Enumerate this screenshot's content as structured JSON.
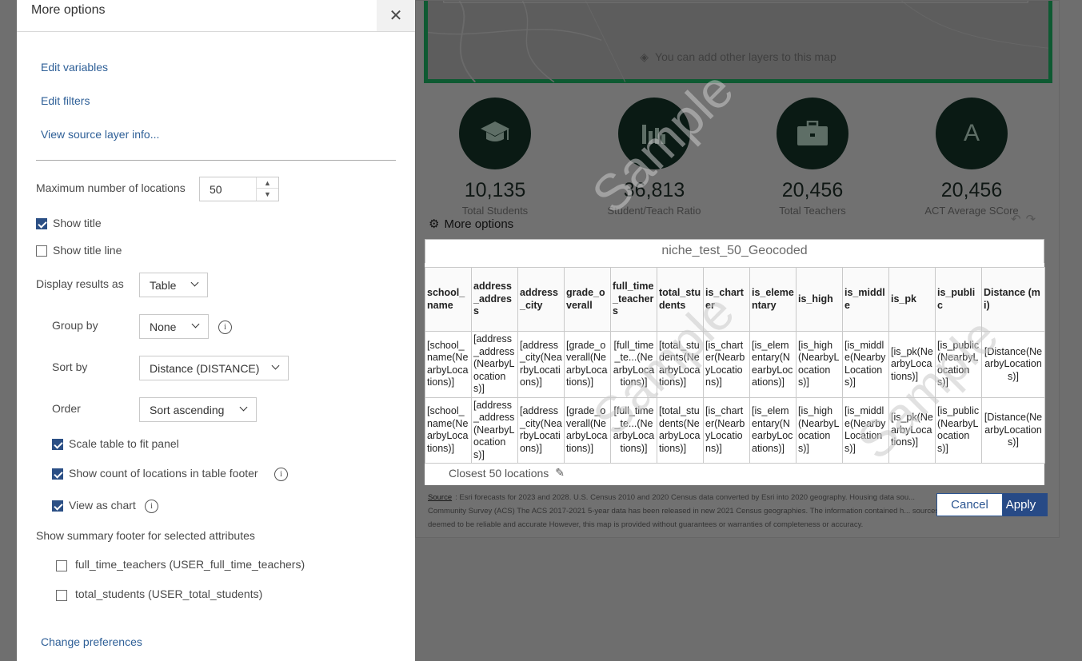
{
  "panel": {
    "title": "More options",
    "close_icon": "close-icon",
    "links": {
      "edit_variables": "Edit variables",
      "edit_filters": "Edit filters",
      "view_source": "View source layer info...",
      "change_preferences": "Change preferences"
    },
    "max_locations_label": "Maximum number of locations",
    "max_locations_value": "50",
    "show_title": {
      "label": "Show title",
      "checked": true
    },
    "show_title_line": {
      "label": "Show title line",
      "checked": false
    },
    "display_results_label": "Display results as",
    "display_results_value": "Table",
    "group_by_label": "Group by",
    "group_by_value": "None",
    "sort_by_label": "Sort by",
    "sort_by_value": "Distance (DISTANCE)",
    "order_label": "Order",
    "order_value": "Sort ascending",
    "scale_table": {
      "label": "Scale table to fit panel",
      "checked": true
    },
    "show_count": {
      "label": "Show count of locations in table footer",
      "checked": true
    },
    "view_chart": {
      "label": "View as chart",
      "checked": true
    },
    "summary_footer_label": "Show summary footer for selected attributes",
    "summary_attrs": [
      {
        "label": "full_time_teachers (USER_full_time_teachers)",
        "checked": false
      },
      {
        "label": "total_students (USER_total_students)",
        "checked": false
      }
    ]
  },
  "app": {
    "map_hint": "You can add other layers to this map",
    "stats": [
      {
        "value": "10,135",
        "label": "Total Students",
        "icon": "graduation-cap-icon"
      },
      {
        "value": "36,813",
        "label": "Student/Teach Ratio",
        "icon": "bar-chart-icon"
      },
      {
        "value": "20,456",
        "label": "Total Teachers",
        "icon": "briefcase-icon"
      },
      {
        "value": "20,456",
        "label": "ACT Average SCore",
        "icon": "letter-a-icon"
      }
    ],
    "more_options": "More options",
    "table_title": "niche_test_50_Geocoded",
    "columns": [
      "school_name",
      "address_address",
      "address_city",
      "grade_overall",
      "full_time_teachers",
      "total_students",
      "is_charter",
      "is_elementary",
      "is_high",
      "is_middle",
      "is_pk",
      "is_public",
      "Distance (mi)"
    ],
    "rows": [
      [
        "[school_name(NearbyLocations)]",
        "[address_address(NearbyLocations)]",
        "[address_city(NearbyLocations)]",
        "[grade_overall(NearbyLocations)]",
        "[full_time_te...(NearbyLocations)]",
        "[total_students(NearbyLocations)]",
        "[is_charter(NearbyLocations)]",
        "[is_elementary(NearbyLocations)]",
        "[is_high(NearbyLocations)]",
        "[is_middle(NearbyLocations)]",
        "[is_pk(NearbyLocations)]",
        "[is_public(NearbyLocations)]",
        "[Distance(NearbyLocations)]"
      ],
      [
        "[school_name(NearbyLocations)]",
        "[address_address(NearbyLocations)]",
        "[address_city(NearbyLocations)]",
        "[grade_overall(NearbyLocations)]",
        "[full_time_te...(NearbyLocations)]",
        "[total_students(NearbyLocations)]",
        "[is_charter(NearbyLocations)]",
        "[is_elementary(NearbyLocations)]",
        "[is_high(NearbyLocations)]",
        "[is_middle(NearbyLocations)]",
        "[is_pk(NearbyLocations)]",
        "[is_public(NearbyLocations)]",
        "[Distance(NearbyLocations)]"
      ]
    ],
    "footer": "Closest 50 locations",
    "watermark": "Sample",
    "source_link": "Source",
    "source_text": ": Esri forecasts for 2023 and 2028. U.S. Census 2010 and 2020 Census data converted by Esri into 2020 geography. Housing data sou... Community Survey (ACS) The ACS 2017-2021 5-year data has been released in new 2021 Census geographies. The information contained h... sources deemed to be reliable and accurate However, this map is provided without guarantees or warranties of completeness or accuracy.",
    "cancel": "Cancel",
    "apply": "Apply"
  },
  "colors": {
    "accent": "#2b4f85",
    "link": "#2e5f97",
    "map_border": "#0e5a32"
  }
}
